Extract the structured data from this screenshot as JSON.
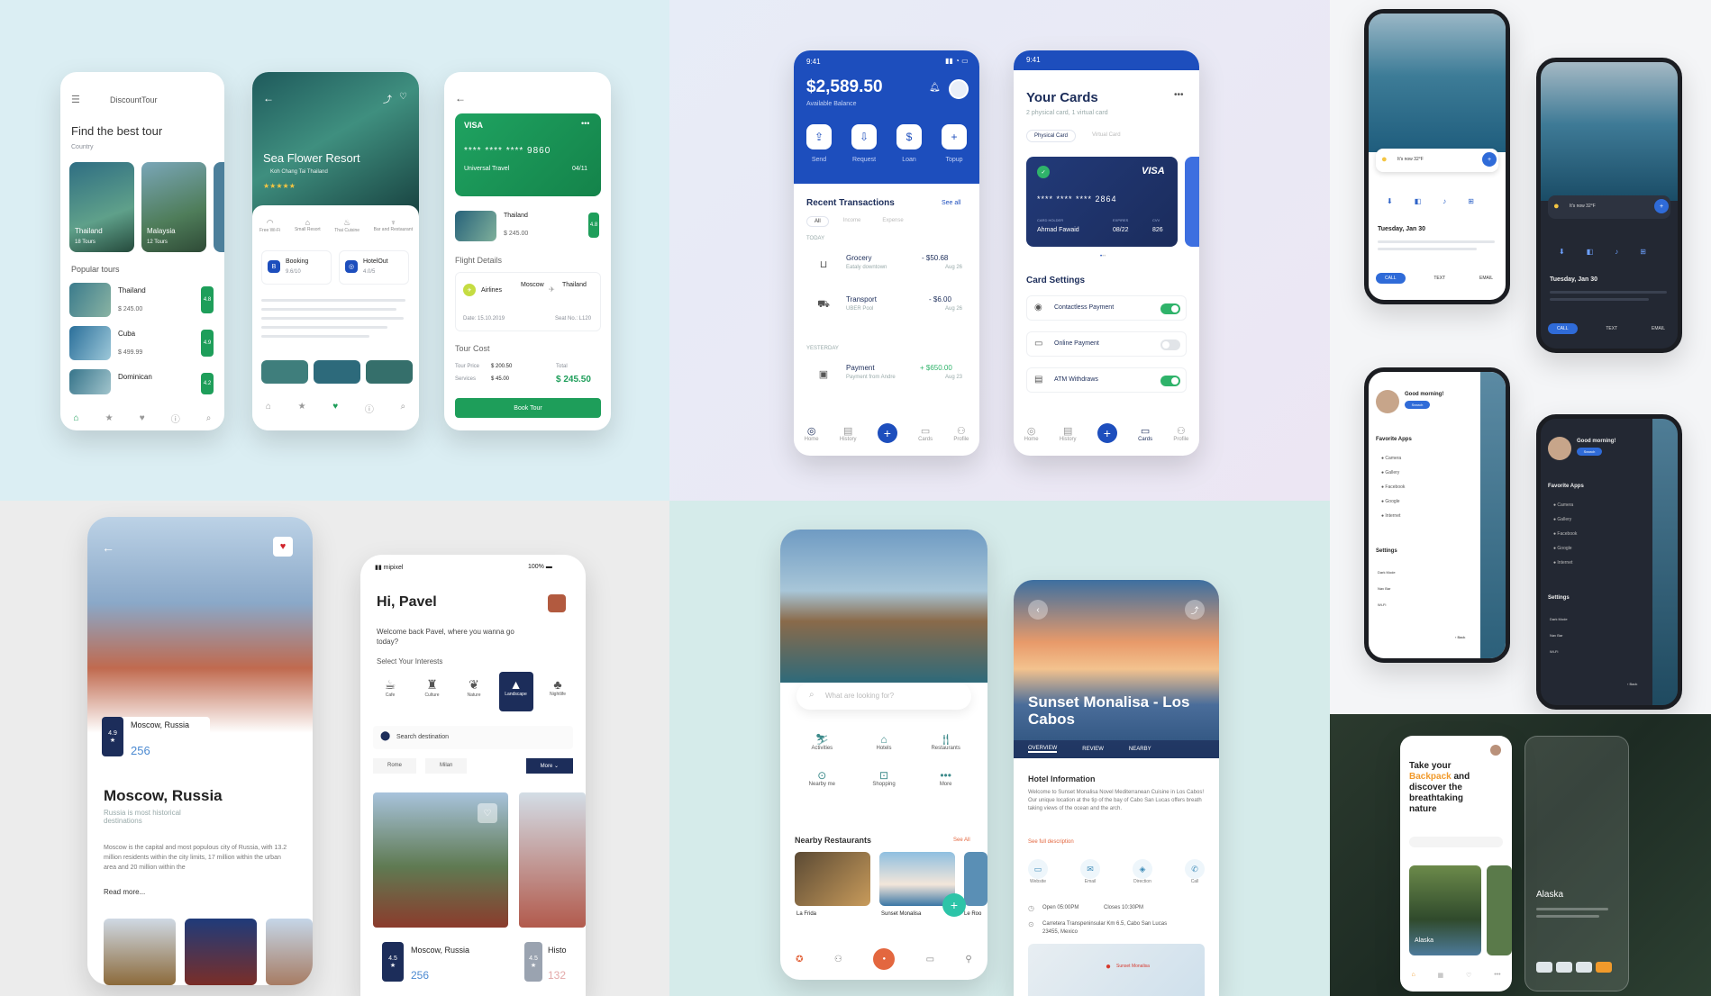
{
  "travel": {
    "logo": "DiscountTour",
    "heading": "Find the best tour",
    "country_label": "Country",
    "countries": [
      {
        "name": "Thailand",
        "tours": "18 Tours"
      },
      {
        "name": "Malaysia",
        "tours": "12 Tours"
      }
    ],
    "popular_label": "Popular tours",
    "popular": [
      {
        "name": "Thailand",
        "price": "$ 245.00",
        "rating": "4.8"
      },
      {
        "name": "Cuba",
        "price": "$ 499.99",
        "rating": "4.9"
      },
      {
        "name": "Dominican",
        "price": "",
        "rating": "4.2"
      }
    ],
    "resort_title": "Sea Flower Resort",
    "resort_location": "Koh Chang Tai Thailand",
    "resort_amenities": [
      "Free Wi-Fi",
      "Small Resort",
      "Thai Cuisine",
      "Bar and Restaurant"
    ],
    "resort_booking": {
      "label": "Booking",
      "score": "9.6/10"
    },
    "resort_hotel": {
      "label": "HotelOut",
      "score": "4.0/5"
    },
    "visa": {
      "brand": "VISA",
      "number": "**** **** **** 9860",
      "holder": "Universal Travel",
      "expiry": "04/11"
    },
    "trip": {
      "name": "Thailand",
      "price": "$ 245.00"
    },
    "flight_label": "Flight Details",
    "flight": {
      "airline": "Airlines",
      "from": "Moscow",
      "to": "Thailand",
      "date": "Date: 15.10.2019",
      "seat": "Seat No.: L120"
    },
    "cost_label": "Tour Cost",
    "cost": {
      "tour_price_label": "Tour Price",
      "tour_price": "$ 200.50",
      "services_label": "Services",
      "services": "$ 45.00",
      "total_label": "Total",
      "total": "$ 245.50"
    },
    "book_button": "Book Tour"
  },
  "bank": {
    "time": "9:41",
    "balance": "$2,589.50",
    "balance_label": "Available Balance",
    "actions": [
      "Send",
      "Request",
      "Loan",
      "Topup"
    ],
    "recent_label": "Recent Transactions",
    "see_all": "See all",
    "filters": [
      "All",
      "Income",
      "Expense"
    ],
    "today_label": "TODAY",
    "yesterday_label": "YESTERDAY",
    "transactions": [
      {
        "name": "Grocery",
        "sub": "Eataly downtown",
        "amount": "- $50.68",
        "date": "Aug 26"
      },
      {
        "name": "Transport",
        "sub": "UBER Pool",
        "amount": "- $6.00",
        "date": "Aug 26"
      },
      {
        "name": "Payment",
        "sub": "Payment from Andre",
        "amount": "+ $650.00",
        "date": "Aug 23"
      }
    ],
    "nav": [
      "Home",
      "History",
      "Cards",
      "Profile"
    ],
    "cards_title": "Your Cards",
    "cards_sub": "2 physical card, 1 virtual card",
    "card_tabs": [
      "Physical Card",
      "Virtual Card"
    ],
    "card": {
      "brand": "VISA",
      "number": "**** **** **** 2864",
      "holder_label": "CARD HOLDER",
      "holder": "Ahmad Fawaid",
      "expires_label": "EXPIRES",
      "expires": "08/22",
      "cvv_label": "CVV",
      "cvv": "826"
    },
    "settings_label": "Card Settings",
    "settings": [
      {
        "label": "Contactless Payment",
        "on": true
      },
      {
        "label": "Online Payment",
        "on": false
      },
      {
        "label": "ATM Withdraws",
        "on": true
      }
    ]
  },
  "android": {
    "weather": "It's now 32°F",
    "date": "Tuesday, Jan 30",
    "actions": [
      "CALL",
      "TEXT",
      "EMAIL"
    ],
    "greeting": "Good morning!",
    "search": "Search",
    "fav_label": "Favorite Apps",
    "apps": [
      "Camera",
      "Gallery",
      "Facebook",
      "Google",
      "Internet"
    ],
    "settings_label": "Settings",
    "settings": [
      "Dark Mode",
      "Nav Bar",
      "Wi-Fi"
    ],
    "back": "Back"
  },
  "moscow": {
    "city": "Moscow, Russia",
    "rating": "4.9",
    "count": "256",
    "title": "Moscow, Russia",
    "subtitle": "Russia is most historical destinations",
    "body": "Moscow is the capital and most populous city of Russia, with 13.2 million residents within the city limits, 17 million within the urban area and 20 million within the",
    "read_more": "Read more..."
  },
  "interests": {
    "carrier": "mipixel",
    "battery": "100%",
    "greeting": "Hi, Pavel",
    "welcome": "Welcome back Pavel, where you wanna go today?",
    "select_label": "Select Your Interests",
    "categories": [
      "Cafe",
      "Culture",
      "Nature",
      "Landscape",
      "Nightlife"
    ],
    "search_placeholder": "Search destination",
    "chips": [
      "Rome",
      "Milan",
      "More"
    ],
    "card1": {
      "title": "Moscow, Russia",
      "rating": "4.5",
      "count": "256"
    },
    "card2": {
      "title": "Histo",
      "rating": "4.5",
      "count": "132"
    }
  },
  "explore": {
    "search_placeholder": "What are looking for?",
    "categories": [
      "Activities",
      "Hotels",
      "Restaurants",
      "Nearby me",
      "Shopping",
      "More"
    ],
    "nearby_label": "Nearby Restaurants",
    "see_all": "See All",
    "restaurants": [
      "La Frida",
      "Sunset Monalisa",
      "Le Roo"
    ],
    "hotel_title": "Sunset Monalisa - Los Cabos",
    "tabs": [
      "OVERVIEW",
      "REVIEW",
      "NEARBY"
    ],
    "info_label": "Hotel Information",
    "info": "Welcome to Sunset Monalisa Novel Mediterranean Cuisine in Los Cabos! Our unique location at the tip of the bay of Cabo San Lucas offers breath taking views of the ocean and the arch.",
    "see_full": "See full description",
    "contacts": [
      "Website",
      "Email",
      "Direction",
      "Call"
    ],
    "hours_open": "Open 05:00PM",
    "hours_close": "Closes 10:30PM",
    "address": "Carretera Transpeninsular Km 6.5, Cabo San Lucas 23455, Mexico",
    "map_label": "Sunset Monalisa"
  },
  "backpack": {
    "headline_1": "Take your",
    "headline_accent": "Backpack",
    "headline_2": "and discover the breathtaking nature",
    "place1": "Alaska",
    "place2": "Alaska"
  },
  "colors": {
    "green": "#1e9e5a",
    "blue": "#1d4ebd",
    "navy": "#1c2d5a",
    "dark": "#1f2430",
    "orange": "#f19a2b"
  }
}
